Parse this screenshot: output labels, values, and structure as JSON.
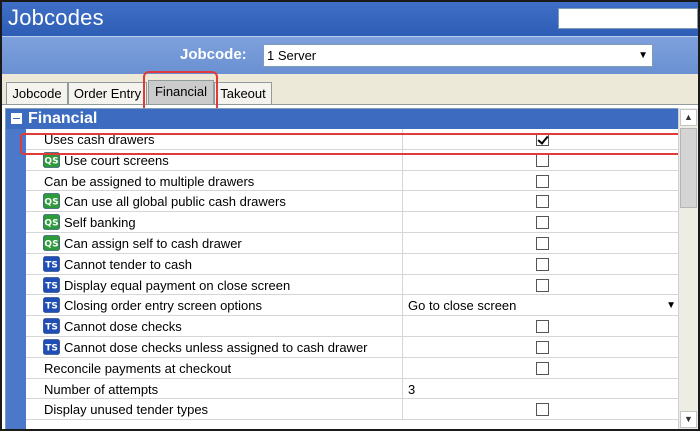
{
  "window": {
    "title": "Jobcodes"
  },
  "jobcode": {
    "label": "Jobcode:",
    "selected": "1 Server"
  },
  "tabs": [
    {
      "label": "Jobcode",
      "active": false
    },
    {
      "label": "Order Entry",
      "active": false
    },
    {
      "label": "Financial",
      "active": true
    },
    {
      "label": "Takeout",
      "active": false
    }
  ],
  "section": {
    "title": "Financial"
  },
  "rows": [
    {
      "label": "Uses cash drawers",
      "icon": "",
      "type": "checkbox",
      "checked": true
    },
    {
      "label": "Use court screens",
      "icon": "qs-icon",
      "type": "checkbox",
      "checked": false
    },
    {
      "label": "Can be assigned to multiple drawers",
      "icon": "",
      "type": "checkbox",
      "checked": false
    },
    {
      "label": "Can use all global public cash drawers",
      "icon": "qs-icon",
      "type": "checkbox",
      "checked": false
    },
    {
      "label": "Self banking",
      "icon": "qs-icon",
      "type": "checkbox",
      "checked": false
    },
    {
      "label": "Can assign self to cash drawer",
      "icon": "qs-icon",
      "type": "checkbox",
      "checked": false
    },
    {
      "label": "Cannot tender to cash",
      "icon": "ts-icon",
      "type": "checkbox",
      "checked": false
    },
    {
      "label": "Display equal payment on close screen",
      "icon": "ts-icon",
      "type": "checkbox",
      "checked": false
    },
    {
      "label": "Closing order entry screen options",
      "icon": "ts-icon",
      "type": "select",
      "value": "Go to close screen"
    },
    {
      "label": "Cannot dose checks",
      "icon": "ts-icon",
      "type": "checkbox",
      "checked": false
    },
    {
      "label": "Cannot dose checks unless assigned to cash drawer",
      "icon": "ts-icon",
      "type": "checkbox",
      "checked": false
    },
    {
      "label": "Reconcile payments at checkout",
      "icon": "",
      "type": "checkbox",
      "checked": false
    },
    {
      "label": "Number of attempts",
      "icon": "",
      "type": "text",
      "value": "3"
    },
    {
      "label": "Display unused tender types",
      "icon": "",
      "type": "checkbox",
      "checked": false
    }
  ],
  "icons": {
    "qs-icon": {
      "text": "QS",
      "color": "#2e9b3a"
    },
    "ts-icon": {
      "text": "TS",
      "color": "#1f4fb5"
    }
  },
  "colors": {
    "highlight": "#e03a3a",
    "titlebar": "#2e5db5",
    "section": "#3d6bc0"
  }
}
